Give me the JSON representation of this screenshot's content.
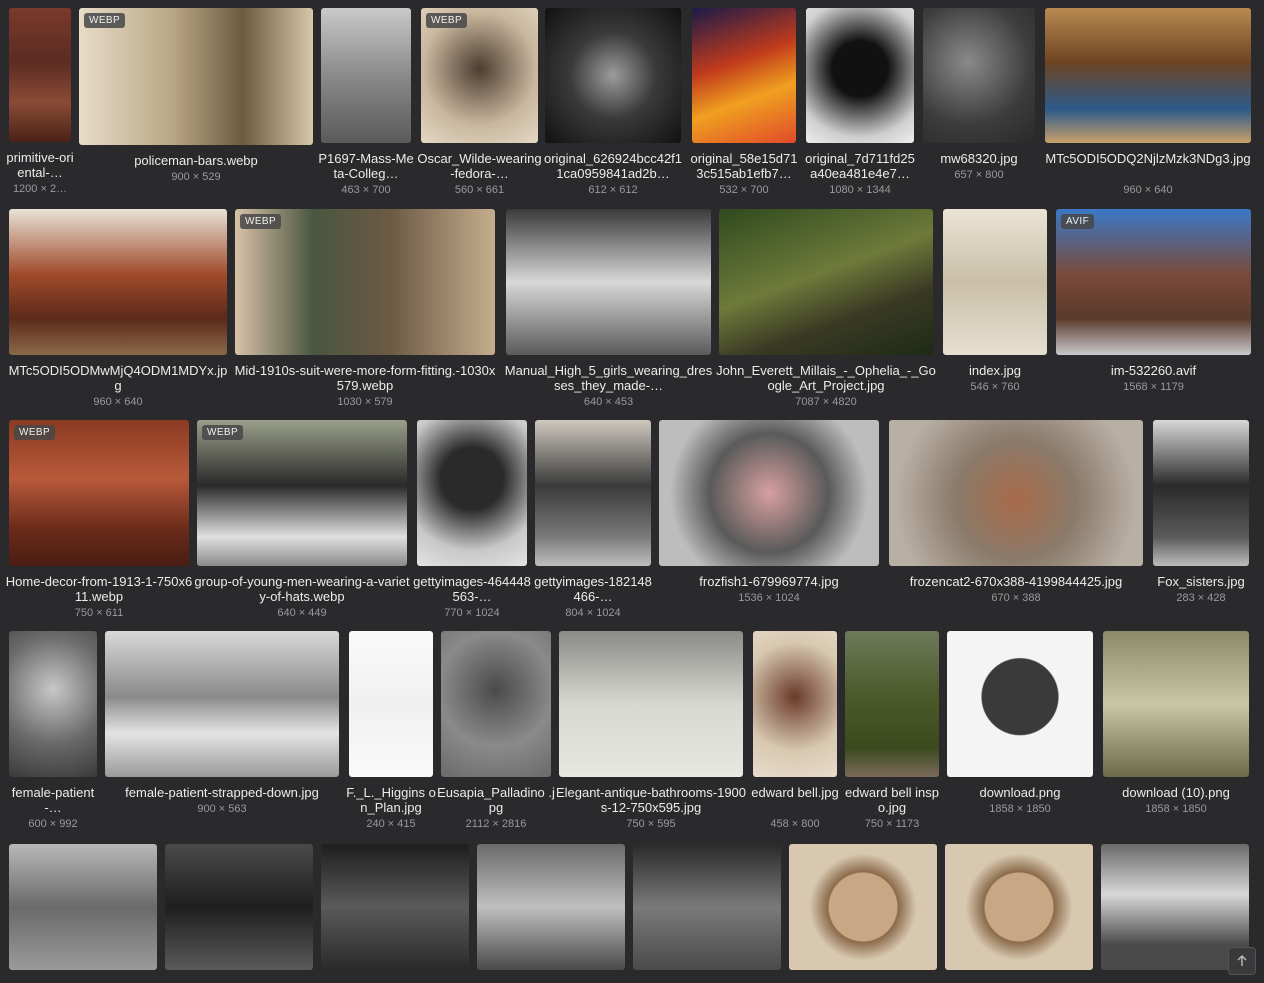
{
  "ui": {
    "scroll_top_icon": "arrow-up-icon",
    "colors": {
      "background": "#2a2a2c",
      "filename": "#ececec",
      "dimensions": "#9a9a9c"
    }
  },
  "files": [
    {
      "name": "primitive-oriental-…",
      "dims": "1200 × 2…",
      "lines": 2,
      "bg": "linear-gradient(180deg,#7a3a2c,#5c2b22 40%,#8a4b36 70%,#4a2218)"
    },
    {
      "name": "policeman-bars.webp",
      "dims": "900 × 529",
      "badge": "WEBP",
      "lines": 1,
      "bg": "linear-gradient(90deg,#e8dcc8,#b9a685 40%,#6e5a40 70%,#d7c7aa)"
    },
    {
      "name": "P1697-Mass-Meta-Colleg…",
      "dims": "463 × 700",
      "lines": 2,
      "bg": "linear-gradient(180deg,#c9c9c9,#8a8a8a 50%,#5a5a5a)"
    },
    {
      "name": "Oscar_Wilde-wearing-fedora-…",
      "dims": "560 × 661",
      "badge": "WEBP",
      "lines": 2,
      "bg": "radial-gradient(circle at 50% 45%,#4e3d30,#c9b79e 60%,#e4d8c4)"
    },
    {
      "name": "original_626924bcc42f11ca0959841ad2b…",
      "dims": "612 × 612",
      "lines": 2,
      "bg": "radial-gradient(circle at 50% 50%,#9c9c9c,#3a3a3a 45%,#111)"
    },
    {
      "name": "original_58e15d713c515ab1efb7…",
      "dims": "532 × 700",
      "lines": 2,
      "bg": "linear-gradient(160deg,#1b1b4a,#c03a1c 40%,#f0a020 65%,#e04a2a)"
    },
    {
      "name": "original_7d711fd25a40ea481e4e7…",
      "dims": "1080 × 1344",
      "lines": 2,
      "bg": "radial-gradient(circle at 50% 45%,#111 30%,#cfcfcf 75%,#eee)"
    },
    {
      "name": "mw68320.jpg",
      "dims": "657 × 800",
      "lines": 1,
      "bg": "radial-gradient(circle at 40% 40%,#8a8a8a,#3c3c3c 60%,#2a2a2a)"
    },
    {
      "name": "MTc5ODI5ODQ2NjlzMzk3NDg3.jpg",
      "dims": "960 × 640",
      "lines": 2,
      "bg": "linear-gradient(180deg,#b98a52,#6e4422 40%,#2c5a8a 75%,#c9a06a)"
    },
    {
      "name": "MTc5ODI5ODMwMjQ4ODM1MDYx.jpg",
      "dims": "960 × 640",
      "lines": 2,
      "bg": "linear-gradient(180deg,#e8e2d6,#a04a2a 45%,#5c2a1a 75%,#8a6a4a)"
    },
    {
      "name": "Mid-1910s-suit-were-more-form-fitting.-1030x579.webp",
      "dims": "1030 × 579",
      "badge": "WEBP",
      "lines": 2,
      "bg": "linear-gradient(90deg,#d9c2a8,#4a5640 30%,#6c5a44 60%,#c6ad8e)"
    },
    {
      "name": "Manual_High_5_girls_wearing_dresses_they_made-…",
      "dims": "640 × 453",
      "lines": 2,
      "bg": "linear-gradient(180deg,#3a3a3a,#d8d8d8 50%,#5a5a5a)"
    },
    {
      "name": "John_Everett_Millais_-_Ophelia_-_Google_Art_Project.jpg",
      "dims": "7087 × 4820",
      "lines": 2,
      "bg": "linear-gradient(160deg,#2f4a1e,#6e7a3a 45%,#3a3a24 70%,#1e2a14)"
    },
    {
      "name": "index.jpg",
      "dims": "546 × 760",
      "lines": 1,
      "bg": "linear-gradient(180deg,#ebe4d4,#c9bfa8 50%,#e6dfcf)"
    },
    {
      "name": "im-532260.avif",
      "dims": "1568 × 1179",
      "badge": "AVIF",
      "lines": 1,
      "bg": "linear-gradient(180deg,#3a78c6,#7a4a3a 45%,#5a3a2a 75%,#c9c9cc)"
    },
    {
      "name": "Home-decor-from-1913-1-750x611.webp",
      "dims": "750 × 611",
      "badge": "WEBP",
      "lines": 2,
      "bg": "linear-gradient(180deg,#8a3a22,#b85a3a 40%,#6a2a1a 75%,#4a1e12)"
    },
    {
      "name": "group-of-young-men-wearing-a-variety-of-hats.webp",
      "dims": "640 × 449",
      "badge": "WEBP",
      "lines": 2,
      "bg": "linear-gradient(180deg,#9aa08a,#2a2a2a 45%,#e0e0e0 80%,#8a8a8a)"
    },
    {
      "name": "gettyimages-464448563-…",
      "dims": "770 × 1024",
      "lines": 2,
      "bg": "radial-gradient(circle at 50% 40%,#2a2a2a 30%,#c8c8c8 70%,#e4e4e4)"
    },
    {
      "name": "gettyimages-182148466-…",
      "dims": "804 × 1024",
      "lines": 2,
      "bg": "linear-gradient(180deg,#cfc9bf,#3a3a3a 45%,#7a7a7a 80%,#bfbfbf)"
    },
    {
      "name": "frozfish1-679969774.jpg",
      "dims": "1536 × 1024",
      "lines": 1,
      "bg": "radial-gradient(circle at 50% 50%,#d8a0a0,#5a5a5a 45%,#bdbdbd 75%)"
    },
    {
      "name": "frozencat2-670x388-4199844425.jpg",
      "dims": "670 × 388",
      "lines": 1,
      "bg": "radial-gradient(circle at 50% 55%,#a86a4a,#8a7a6a 40%,#b8b0a4 80%)"
    },
    {
      "name": "Fox_sisters.jpg",
      "dims": "283 × 428",
      "lines": 1,
      "bg": "linear-gradient(180deg,#d8d8d8,#2a2a2a 45%,#5a5a5a 80%,#bdbdbd)"
    },
    {
      "name": "female-patient-…",
      "dims": "600 × 992",
      "lines": 2,
      "bg": "radial-gradient(circle at 50% 40%,#c8c8c8,#6a6a6a 55%,#3a3a3a)"
    },
    {
      "name": "female-patient-strapped-down.jpg",
      "dims": "900 × 563",
      "lines": 1,
      "bg": "linear-gradient(180deg,#d9d9d9,#8a8a8a 45%,#e4e4e4 70%,#9a9a9a)"
    },
    {
      "name": "F._L._Higgins on_Plan.jpg",
      "dims": "240 × 415",
      "lines": 2,
      "bg": "linear-gradient(180deg,#fafafa,#f0f0f0 50%,#fafafa)"
    },
    {
      "name": "Eusapia_Palladino .jpg",
      "dims": "2112 × 2816",
      "lines": 2,
      "bg": "radial-gradient(circle at 50% 40%,#4a4a4a,#8a8a8a 55%,#6a6a6a)"
    },
    {
      "name": "Elegant-antique-bathrooms-1900s-12-750x595.jpg",
      "dims": "750 × 595",
      "lines": 2,
      "bg": "linear-gradient(180deg,#8a8a86,#d8d8d2 50%,#e8e8e2)"
    },
    {
      "name": "edward bell.jpg",
      "dims": "458 × 800",
      "lines": 2,
      "bg": "radial-gradient(circle at 50% 45%,#6a3a2a,#d8c8b0 60%,#e8dccc)"
    },
    {
      "name": "edward bell inspo.jpg",
      "dims": "750 × 1173",
      "lines": 2,
      "bg": "linear-gradient(180deg,#6e7a5a,#4a5a2a 45%,#3a4a1e 80%,#7a6a5a)"
    },
    {
      "name": "download.png",
      "dims": "1858 × 1850",
      "lines": 1,
      "bg": "radial-gradient(circle at 50% 45%,#3a3a3a 35%,#f4f4f4 36%)"
    },
    {
      "name": "download (10).png",
      "dims": "1858 × 1850",
      "lines": 1,
      "bg": "linear-gradient(180deg,#8a8a6a,#c8c8a8 50%,#6a6a4a)"
    },
    {
      "name": "",
      "dims": "",
      "lines": 0,
      "bg": "linear-gradient(180deg,#b8b8b8,#6a6a6a 50%,#9a9a9a)"
    },
    {
      "name": "",
      "dims": "",
      "lines": 0,
      "bg": "linear-gradient(180deg,#4a4a4a,#1e1e1e 50%,#5a5a5a)"
    },
    {
      "name": "",
      "dims": "",
      "lines": 0,
      "bg": "linear-gradient(180deg,#1e1e1e,#5a5a5a 50%,#2a2a2a)"
    },
    {
      "name": "",
      "dims": "",
      "lines": 0,
      "bg": "linear-gradient(180deg,#6a6a6a,#bfbfbf 50%,#4a4a4a)"
    },
    {
      "name": "",
      "dims": "",
      "lines": 0,
      "bg": "linear-gradient(180deg,#2a2a2a,#7a7a7a 50%,#4a4a4a)"
    },
    {
      "name": "",
      "dims": "",
      "lines": 0,
      "bg": "radial-gradient(circle at 50% 50%,#c8a884 35%,#8a6a4a 36%,#d8c8b0 55%)"
    },
    {
      "name": "",
      "dims": "",
      "lines": 0,
      "bg": "radial-gradient(circle at 50% 50%,#c8a884 35%,#8a6a4a 36%,#d8c8b0 55%)"
    },
    {
      "name": "",
      "dims": "",
      "lines": 0,
      "bg": "linear-gradient(180deg,#6a6a6a,#d8d8d8 40%,#4a4a4a 80%)"
    }
  ]
}
